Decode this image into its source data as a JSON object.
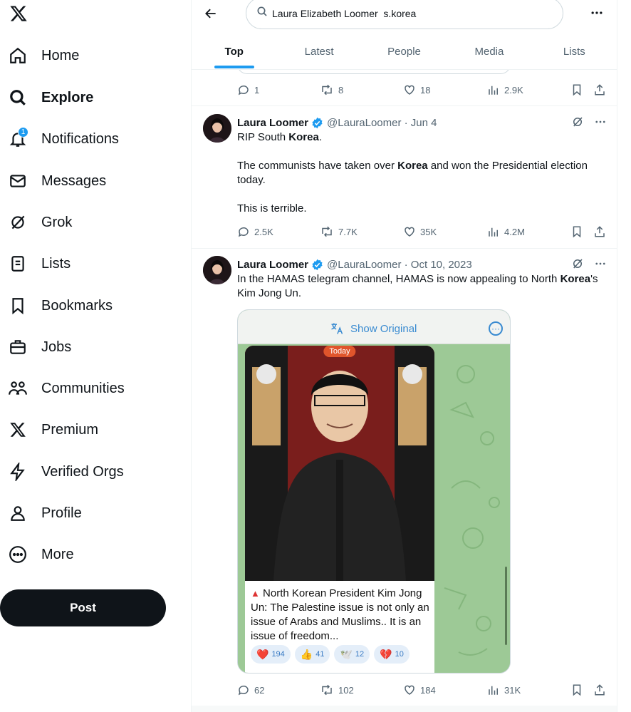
{
  "sidebar": {
    "items": [
      {
        "label": "Home",
        "icon": "home-icon"
      },
      {
        "label": "Explore",
        "icon": "search-icon",
        "active": true
      },
      {
        "label": "Notifications",
        "icon": "bell-icon",
        "badge": "1"
      },
      {
        "label": "Messages",
        "icon": "envelope-icon"
      },
      {
        "label": "Grok",
        "icon": "grok-icon"
      },
      {
        "label": "Lists",
        "icon": "list-icon"
      },
      {
        "label": "Bookmarks",
        "icon": "bookmark-icon"
      },
      {
        "label": "Jobs",
        "icon": "briefcase-icon"
      },
      {
        "label": "Communities",
        "icon": "people-icon"
      },
      {
        "label": "Premium",
        "icon": "x-logo-icon"
      },
      {
        "label": "Verified Orgs",
        "icon": "lightning-icon"
      },
      {
        "label": "Profile",
        "icon": "person-icon"
      },
      {
        "label": "More",
        "icon": "more-circle-icon"
      }
    ],
    "post_label": "Post"
  },
  "search": {
    "query": "Laura Elizabeth Loomer  s.korea"
  },
  "tabs": [
    {
      "label": "Top",
      "active": true
    },
    {
      "label": "Latest"
    },
    {
      "label": "People"
    },
    {
      "label": "Media"
    },
    {
      "label": "Lists"
    }
  ],
  "tweets": [
    {
      "metrics": {
        "replies": "1",
        "reposts": "8",
        "likes": "18",
        "views": "2.9K"
      }
    },
    {
      "name": "Laura Loomer",
      "handle_date": "@LauraLoomer · Jun 4",
      "lines": [
        "RIP South ",
        "Korea",
        ".",
        "The communists have taken over ",
        "Korea",
        " and won the Presidential election today.",
        "This is terrible."
      ],
      "metrics": {
        "replies": "2.5K",
        "reposts": "7.7K",
        "likes": "35K",
        "views": "4.2M"
      }
    },
    {
      "name": "Laura Loomer",
      "handle_date": "@LauraLoomer · Oct 10, 2023",
      "lines": [
        "In the HAMAS telegram channel, HAMAS is now appealing to North ",
        "Korea",
        "'s Kim Jong Un."
      ],
      "media": {
        "show_original": "Show Original",
        "today": "Today",
        "caption": "North Korean President Kim Jong Un: The Palestine issue is not only an issue of Arabs and Muslims.. It is an issue of freedom...",
        "reactions": [
          {
            "emoji": "❤️",
            "count": "194"
          },
          {
            "emoji": "👍",
            "count": "41"
          },
          {
            "emoji": "🕊️",
            "count": "12"
          },
          {
            "emoji": "💔",
            "count": "10"
          }
        ]
      },
      "metrics": {
        "replies": "62",
        "reposts": "102",
        "likes": "184",
        "views": "31K"
      }
    }
  ],
  "colors": {
    "accent": "#1d9bf0",
    "text": "#0f1419",
    "muted": "#536471"
  }
}
